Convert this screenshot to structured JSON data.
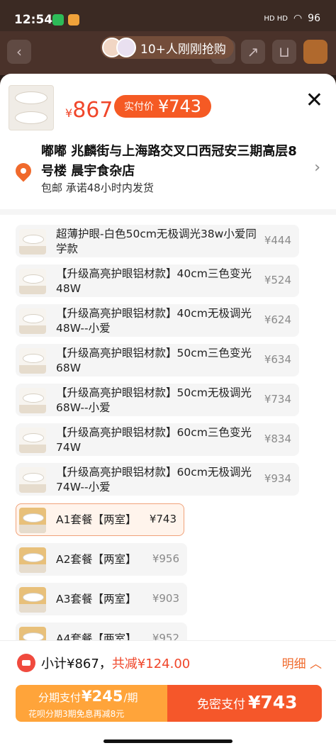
{
  "status": {
    "time": "12:54",
    "battery": "96",
    "signal": "HD HD"
  },
  "banner": {
    "text": "10+人刚刚抢购"
  },
  "product": {
    "price_symbol": "¥",
    "price": "867",
    "pay_label": "实付价",
    "pay_price": "¥743"
  },
  "address": {
    "text": "嘟嘟 兆麟街与上海路交叉口西冠安三期高层8 号楼 晨宇食杂店",
    "shipping": "包邮  承诺48小时内发货"
  },
  "options": [
    {
      "name": "超薄护眼-白色50cm无极调光38w小爱同学款",
      "price": "¥444"
    },
    {
      "name": "【升级高亮护眼铝材款】40cm三色变光48W",
      "price": "¥524"
    },
    {
      "name": "【升级高亮护眼铝材款】40cm无极调光48W--小爱",
      "price": "¥624"
    },
    {
      "name": "【升级高亮护眼铝材款】50cm三色变光68W",
      "price": "¥634"
    },
    {
      "name": "【升级高亮护眼铝材款】50cm无极调光68W--小爱",
      "price": "¥734"
    },
    {
      "name": "【升级高亮护眼铝材款】60cm三色变光74W",
      "price": "¥834"
    },
    {
      "name": "【升级高亮护眼铝材款】60cm无极调光74W--小爱",
      "price": "¥934"
    },
    {
      "name": "A1套餐【两室】",
      "price": "¥743",
      "selected": true
    },
    {
      "name": "A2套餐【两室】",
      "price": "¥956"
    },
    {
      "name": "A3套餐【两室】",
      "price": "¥903"
    },
    {
      "name": "A4套餐【两室】",
      "price": "¥952"
    }
  ],
  "footer": {
    "subtotal": "小计¥867，",
    "discount": "共减¥124.00",
    "detail": "明细 ︿"
  },
  "pay": {
    "installment_prefix": "分期支付",
    "installment_amount": "¥245",
    "installment_suffix": "/期",
    "installment_note": "花呗分期3期免息再减8元",
    "direct_label": "免密支付",
    "direct_amount": "¥743"
  },
  "colors": {
    "accent": "#f5572a",
    "orange": "#ffa43a",
    "price_red": "#f0462a"
  }
}
